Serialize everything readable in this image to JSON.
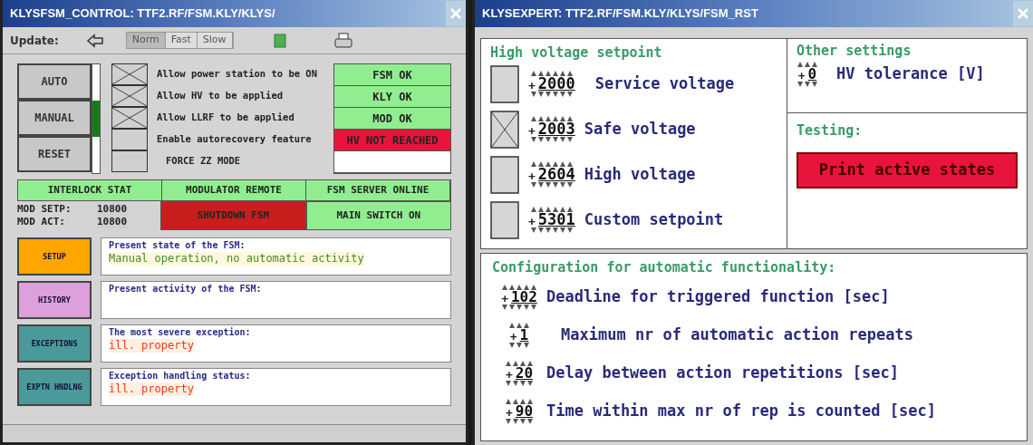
{
  "left_window": {
    "title": "KLYSFSM_CONTROL: TTF2.RF/FSM.KLY/KLYS/",
    "toolbar": {
      "label": "Update:",
      "rates": [
        {
          "label": "Norm",
          "selected": true
        },
        {
          "label": "Fast",
          "selected": false
        },
        {
          "label": "Slow",
          "selected": false
        }
      ]
    },
    "modes": [
      {
        "label": "AUTO",
        "selected": false
      },
      {
        "label": "MANUAL",
        "selected": true
      },
      {
        "label": "RESET",
        "selected": false
      }
    ],
    "checkboxes": [
      {
        "label": "Allow power station to be ON",
        "checked": true
      },
      {
        "label": "Allow HV to be applied",
        "checked": true
      },
      {
        "label": "Allow LLRF to be applied",
        "checked": true
      },
      {
        "label": "Enable autorecovery feature",
        "checked": false
      },
      {
        "label": "FORCE ZZ MODE",
        "checked": false
      }
    ],
    "statuses": [
      {
        "label": "FSM OK",
        "color": "#90ee90"
      },
      {
        "label": "KLY OK",
        "color": "#90ee90"
      },
      {
        "label": "MOD OK",
        "color": "#90ee90"
      },
      {
        "label": "HV NOT REACHED",
        "color": "#e8143c"
      },
      {
        "color": "#ffffff"
      }
    ],
    "indicators": [
      {
        "label": "INTERLOCK STAT",
        "color": "#90ee90"
      },
      {
        "label": "MODULATOR REMOTE",
        "color": "#90ee90"
      },
      {
        "label": "FSM SERVER ONLINE",
        "color": "#90ee90"
      }
    ],
    "readings": [
      {
        "label": "MOD SETP:",
        "value": "10800"
      },
      {
        "label": "MOD ACT:",
        "value": "10800"
      }
    ],
    "actions": [
      {
        "label": "SHUTDOWN FSM",
        "color": "#c81e1e"
      },
      {
        "label": "MAIN SWITCH ON",
        "color": "#90ee90"
      }
    ],
    "panels": [
      {
        "button": "SETUP",
        "color": "#ffa500",
        "title": "Present state of the FSM:",
        "value": "Manual operation, no automatic activity",
        "kind": "info"
      },
      {
        "button": "HISTORY",
        "color": "#dda0dd",
        "title": "Present activity of the FSM:"
      },
      {
        "button": "EXCEPTIONS",
        "color": "#4a9a9a",
        "title": "The most severe exception:",
        "value": "ill. property",
        "kind": "error"
      },
      {
        "button": "EXPTN HNDLNG",
        "color": "#4a9a9a",
        "title": "Exception handling status:",
        "value": "ill. property",
        "kind": "error"
      }
    ]
  },
  "right_window": {
    "title": "KLYSEXPERT: TTF2.RF/FSM.KLY/KLYS/FSM_RST",
    "hv_setpoint": {
      "title": "High voltage setpoint",
      "items": [
        {
          "sign": "+",
          "value": "2000",
          "label": "Service voltage",
          "checked": false
        },
        {
          "sign": "+",
          "value": "2003",
          "label": "Safe voltage",
          "checked": true
        },
        {
          "sign": "+",
          "value": "2604",
          "label": "High voltage",
          "checked": false
        },
        {
          "sign": "+",
          "value": "5301",
          "label": "Custom setpoint",
          "checked": false
        }
      ]
    },
    "other_settings": {
      "title": "Other settings",
      "items": [
        {
          "sign": "+",
          "value": "0",
          "label": "HV tolerance [V]"
        }
      ]
    },
    "testing": {
      "title": "Testing:",
      "button": "Print active states"
    },
    "config": {
      "title": "Configuration for automatic functionality:",
      "items": [
        {
          "sign": "+",
          "value": "102",
          "label": "Deadline for triggered function [sec]"
        },
        {
          "sign": "+",
          "value": "1",
          "label": "Maximum nr of automatic action repeats"
        },
        {
          "sign": "+",
          "value": "20",
          "label": "Delay between action repetitions [sec]"
        },
        {
          "sign": "+",
          "value": "90",
          "label": "Time within max nr of rep is counted [sec]"
        }
      ]
    }
  }
}
